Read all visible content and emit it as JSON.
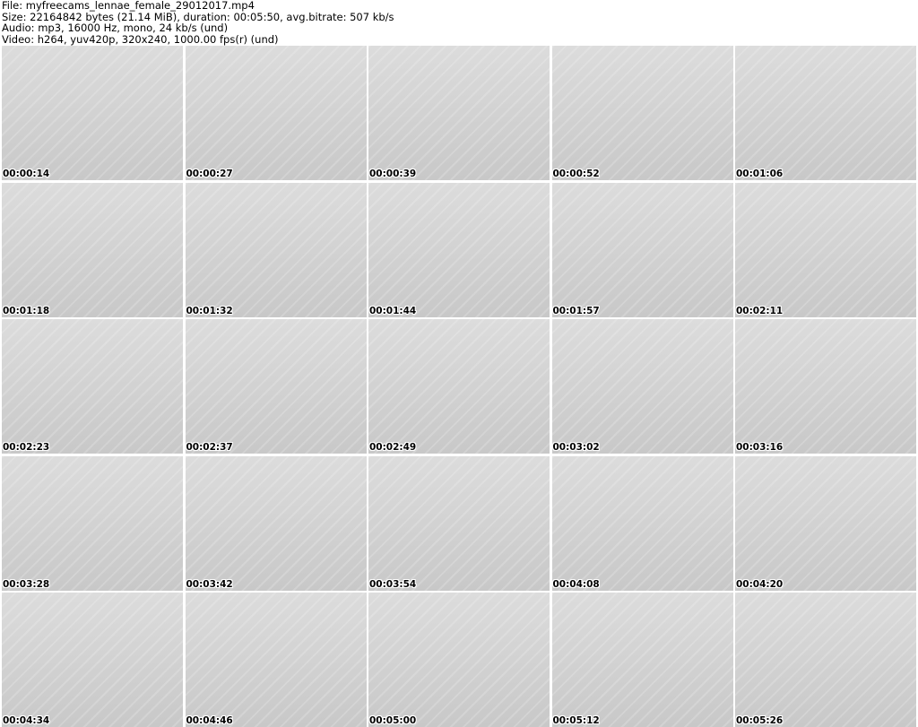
{
  "header": {
    "file_line": "File: myfreecams_lennae_female_29012017.mp4",
    "size_line": "Size: 22164842 bytes (21.14 MiB), duration: 00:05:50, avg.bitrate: 507 kb/s",
    "audio_line": "Audio: mp3, 16000 Hz, mono, 24 kb/s (und)",
    "video_line": "Video: h264, yuv420p, 320x240, 1000.00 fps(r) (und)"
  },
  "frames": [
    {
      "timestamp": "00:00:14"
    },
    {
      "timestamp": "00:00:27"
    },
    {
      "timestamp": "00:00:39"
    },
    {
      "timestamp": "00:00:52"
    },
    {
      "timestamp": "00:01:06"
    },
    {
      "timestamp": "00:01:18"
    },
    {
      "timestamp": "00:01:32"
    },
    {
      "timestamp": "00:01:44"
    },
    {
      "timestamp": "00:01:57"
    },
    {
      "timestamp": "00:02:11"
    },
    {
      "timestamp": "00:02:23"
    },
    {
      "timestamp": "00:02:37"
    },
    {
      "timestamp": "00:02:49"
    },
    {
      "timestamp": "00:03:02"
    },
    {
      "timestamp": "00:03:16"
    },
    {
      "timestamp": "00:03:28"
    },
    {
      "timestamp": "00:03:42"
    },
    {
      "timestamp": "00:03:54"
    },
    {
      "timestamp": "00:04:08"
    },
    {
      "timestamp": "00:04:20"
    },
    {
      "timestamp": "00:04:34"
    },
    {
      "timestamp": "00:04:46"
    },
    {
      "timestamp": "00:05:00"
    },
    {
      "timestamp": "00:05:12"
    },
    {
      "timestamp": "00:05:26"
    }
  ]
}
